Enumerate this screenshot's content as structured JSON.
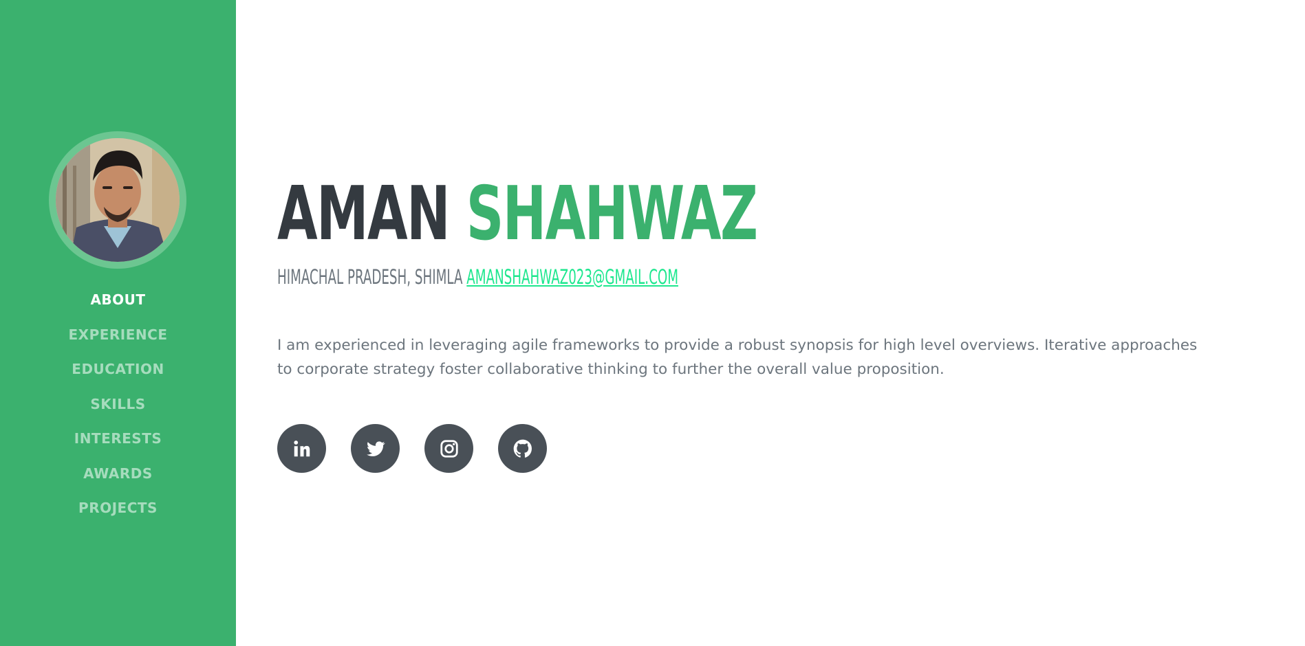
{
  "profile": {
    "first_name": "AMAN",
    "last_name": "SHAHWAZ",
    "location": "HIMACHAL PRADESH, SHIMLA",
    "email": "AMANSHAHWAZ023@GMAIL.COM",
    "bio": "I am experienced in leveraging agile frameworks to provide a robust synopsis for high level overviews. Iterative approaches to corporate strategy foster collaborative thinking to further the overall value proposition."
  },
  "sidebar": {
    "nav_items": [
      {
        "label": "ABOUT",
        "active": true
      },
      {
        "label": "EXPERIENCE",
        "active": false
      },
      {
        "label": "EDUCATION",
        "active": false
      },
      {
        "label": "SKILLS",
        "active": false
      },
      {
        "label": "INTERESTS",
        "active": false
      },
      {
        "label": "AWARDS",
        "active": false
      },
      {
        "label": "PROJECTS",
        "active": false
      }
    ]
  },
  "social_links": [
    {
      "icon": "linkedin-icon"
    },
    {
      "icon": "twitter-icon"
    },
    {
      "icon": "instagram-icon"
    },
    {
      "icon": "github-icon"
    }
  ],
  "colors": {
    "primary": "#3bb16e",
    "dark": "#343a40",
    "muted": "#6c757d",
    "link": "#1de78e",
    "social_bg": "#495057"
  }
}
